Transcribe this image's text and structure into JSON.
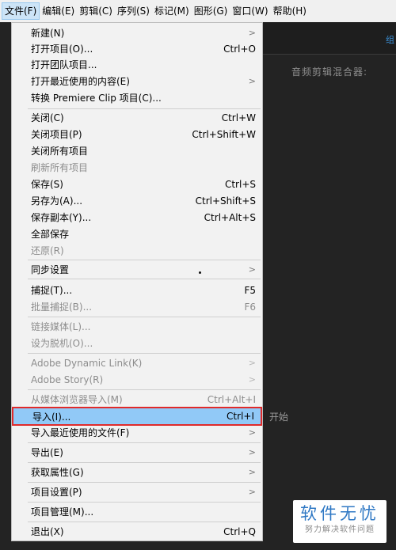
{
  "menubar": {
    "items": [
      {
        "label": "文件(F)",
        "active": true
      },
      {
        "label": "编辑(E)"
      },
      {
        "label": "剪辑(C)"
      },
      {
        "label": "序列(S)"
      },
      {
        "label": "标记(M)"
      },
      {
        "label": "图形(G)"
      },
      {
        "label": "窗口(W)"
      },
      {
        "label": "帮助(H)"
      }
    ]
  },
  "background": {
    "tab_label": "组",
    "mixer_label": "音频剪辑混合器:",
    "start_label": "开始"
  },
  "file_menu": {
    "items": [
      {
        "label": "新建(N)",
        "shortcut": "",
        "submenu": true,
        "disabled": false
      },
      {
        "label": "打开项目(O)...",
        "shortcut": "Ctrl+O",
        "submenu": false,
        "disabled": false
      },
      {
        "label": "打开团队项目...",
        "shortcut": "",
        "submenu": false,
        "disabled": false
      },
      {
        "label": "打开最近使用的内容(E)",
        "shortcut": "",
        "submenu": true,
        "disabled": false
      },
      {
        "label": "转换 Premiere Clip 项目(C)...",
        "shortcut": "",
        "submenu": false,
        "disabled": false
      },
      {
        "label": "关闭(C)",
        "shortcut": "Ctrl+W",
        "submenu": false,
        "disabled": false
      },
      {
        "label": "关闭项目(P)",
        "shortcut": "Ctrl+Shift+W",
        "submenu": false,
        "disabled": false
      },
      {
        "label": "关闭所有项目",
        "shortcut": "",
        "submenu": false,
        "disabled": false
      },
      {
        "label": "刷新所有项目",
        "shortcut": "",
        "submenu": false,
        "disabled": true
      },
      {
        "label": "保存(S)",
        "shortcut": "Ctrl+S",
        "submenu": false,
        "disabled": false
      },
      {
        "label": "另存为(A)...",
        "shortcut": "Ctrl+Shift+S",
        "submenu": false,
        "disabled": false
      },
      {
        "label": "保存副本(Y)...",
        "shortcut": "Ctrl+Alt+S",
        "submenu": false,
        "disabled": false
      },
      {
        "label": "全部保存",
        "shortcut": "",
        "submenu": false,
        "disabled": false
      },
      {
        "label": "还原(R)",
        "shortcut": "",
        "submenu": false,
        "disabled": true
      },
      {
        "label": "同步设置",
        "shortcut": "",
        "submenu": true,
        "disabled": false
      },
      {
        "label": "捕捉(T)...",
        "shortcut": "F5",
        "submenu": false,
        "disabled": false
      },
      {
        "label": "批量捕捉(B)...",
        "shortcut": "F6",
        "submenu": false,
        "disabled": true
      },
      {
        "label": "链接媒体(L)...",
        "shortcut": "",
        "submenu": false,
        "disabled": true
      },
      {
        "label": "设为脱机(O)...",
        "shortcut": "",
        "submenu": false,
        "disabled": true
      },
      {
        "label": "Adobe Dynamic Link(K)",
        "shortcut": "",
        "submenu": true,
        "disabled": true
      },
      {
        "label": "Adobe Story(R)",
        "shortcut": "",
        "submenu": true,
        "disabled": true
      },
      {
        "label": "从媒体浏览器导入(M)",
        "shortcut": "Ctrl+Alt+I",
        "submenu": false,
        "disabled": true
      },
      {
        "label": "导入(I)...",
        "shortcut": "Ctrl+I",
        "submenu": false,
        "disabled": false,
        "highlighted": true
      },
      {
        "label": "导入最近使用的文件(F)",
        "shortcut": "",
        "submenu": true,
        "disabled": false
      },
      {
        "label": "导出(E)",
        "shortcut": "",
        "submenu": true,
        "disabled": false
      },
      {
        "label": "获取属性(G)",
        "shortcut": "",
        "submenu": true,
        "disabled": false
      },
      {
        "label": "项目设置(P)",
        "shortcut": "",
        "submenu": true,
        "disabled": false
      },
      {
        "label": "项目管理(M)...",
        "shortcut": "",
        "submenu": false,
        "disabled": false
      },
      {
        "label": "退出(X)",
        "shortcut": "Ctrl+Q",
        "submenu": false,
        "disabled": false
      }
    ],
    "submenu_arrow": ">"
  },
  "watermark": {
    "title": "软件无忧",
    "subtitle": "努力解决软件问题"
  },
  "colors": {
    "highlight_fill": "#91c9f7",
    "highlight_border": "#e02a2a",
    "watermark_blue": "#2f78c4"
  }
}
